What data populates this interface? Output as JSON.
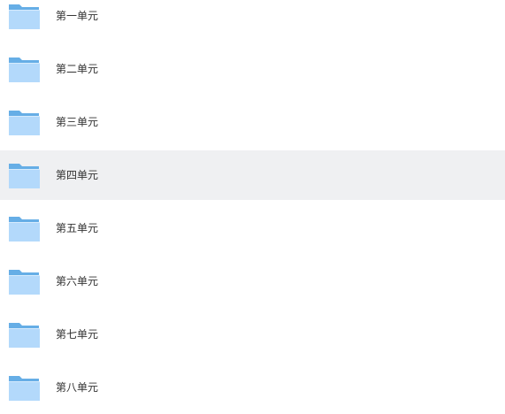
{
  "folders": [
    {
      "label": "第一单元",
      "icon": "folder-icon"
    },
    {
      "label": "第二单元",
      "icon": "folder-icon"
    },
    {
      "label": "第三单元",
      "icon": "folder-icon"
    },
    {
      "label": "第四单元",
      "icon": "folder-icon",
      "selected": true
    },
    {
      "label": "第五单元",
      "icon": "folder-icon"
    },
    {
      "label": "第六单元",
      "icon": "folder-icon"
    },
    {
      "label": "第七单元",
      "icon": "folder-icon"
    },
    {
      "label": "第八单元",
      "icon": "folder-icon"
    }
  ],
  "colors": {
    "selected_row_bg": "#eff0f2",
    "folder_back": "#66aee6",
    "folder_front": "#b3d9fb",
    "text": "#333333"
  }
}
